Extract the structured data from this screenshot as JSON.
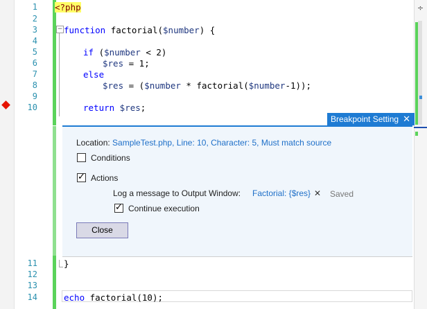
{
  "editor": {
    "line_numbers": [
      "1",
      "2",
      "3",
      "4",
      "5",
      "6",
      "7",
      "8",
      "9",
      "10",
      "11",
      "12",
      "13",
      "14"
    ],
    "code": {
      "l1_tag": "<?php",
      "l3_kw": "function",
      "l3_name": " factorial(",
      "l3_var": "$number",
      "l3_end": ") {",
      "l5_kw": "if",
      "l5_a": " (",
      "l5_var": "$number",
      "l5_b": " < 2)",
      "l6_var": "$res",
      "l6_b": " = 1;",
      "l7_kw": "else",
      "l8_var": "$res",
      "l8_b": " = (",
      "l8_var2": "$number",
      "l8_c": " * factorial(",
      "l8_var3": "$number",
      "l8_d": "-1));",
      "l10_kw": "return",
      "l10_var": " $res",
      "l10_end": ";",
      "l11": "}",
      "l14_kw": "echo",
      "l14_rest": " factorial(10);"
    },
    "fold_glyph": "−",
    "splitter_glyph": "÷"
  },
  "breakpoint_settings": {
    "tab_title": "Breakpoint Setting",
    "close_glyph": "✕",
    "location_label": "Location:",
    "location_value": "SampleTest.php, Line: 10, Character: 5, Must match source",
    "conditions_label": "Conditions",
    "conditions_checked": false,
    "actions_label": "Actions",
    "actions_checked": true,
    "log_label": "Log a message to Output Window:",
    "log_value": "Factorial: {$res}",
    "clear_glyph": "✕",
    "saved_label": "Saved",
    "continue_label": "Continue execution",
    "continue_checked": true,
    "close_button": "Close"
  },
  "colors": {
    "accent": "#1e7bd3",
    "breakpoint": "#e51400",
    "changed_lines": "#5bd35b",
    "keyword": "#0000ff",
    "line_number": "#2b91af"
  }
}
